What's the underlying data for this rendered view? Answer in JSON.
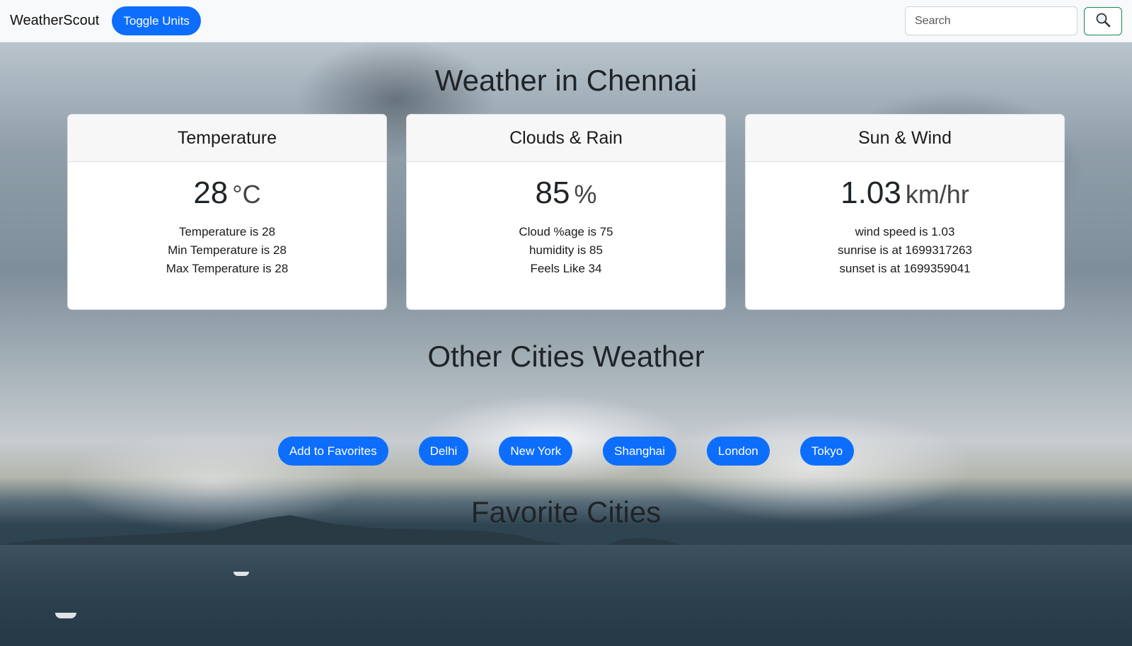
{
  "navbar": {
    "brand": "WeatherScout",
    "toggle_label": "Toggle Units",
    "search_placeholder": "Search"
  },
  "main": {
    "title": "Weather in Chennai",
    "cards": [
      {
        "header": "Temperature",
        "value": "28",
        "unit": "°C",
        "lines": [
          "Temperature is 28",
          "Min Temperature is 28",
          "Max Temperature is 28"
        ]
      },
      {
        "header": "Clouds & Rain",
        "value": "85",
        "unit": "%",
        "lines": [
          "Cloud %age is 75",
          "humidity is 85",
          "Feels Like 34"
        ]
      },
      {
        "header": "Sun & Wind",
        "value": "1.03",
        "unit": "km/hr",
        "lines": [
          "wind speed is 1.03",
          "sunrise is at 1699317263",
          "sunset is at 1699359041"
        ]
      }
    ],
    "other_title": "Other Cities Weather",
    "city_buttons": [
      "Add to Favorites",
      "Delhi",
      "New York",
      "Shanghai",
      "London",
      "Tokyo"
    ],
    "favorites_title": "Favorite Cities"
  },
  "colors": {
    "accent": "#0d6efd",
    "search_border": "#198754"
  },
  "icons": {
    "search_button": "magnifier-icon"
  }
}
